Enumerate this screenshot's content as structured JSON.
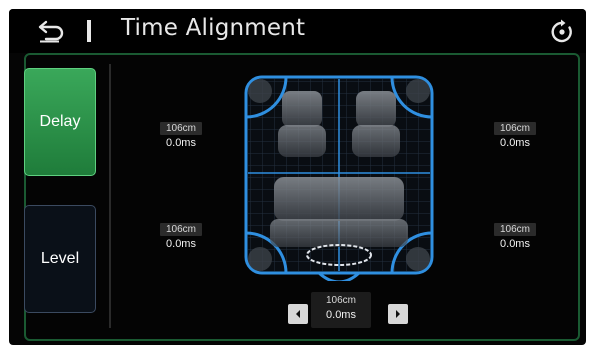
{
  "header": {
    "title": "Time Alignment",
    "back_icon": "back-arrow-icon",
    "reset_icon": "reset-icon"
  },
  "sidebar": {
    "delay_label": "Delay",
    "level_label": "Level",
    "active": "Delay"
  },
  "speakers": {
    "front_left": {
      "distance": "106cm",
      "delay": "0.0ms"
    },
    "front_right": {
      "distance": "106cm",
      "delay": "0.0ms"
    },
    "rear_left": {
      "distance": "106cm",
      "delay": "0.0ms"
    },
    "rear_right": {
      "distance": "106cm",
      "delay": "0.0ms"
    },
    "subwoofer": {
      "distance": "106cm",
      "delay": "0.0ms"
    }
  },
  "controls": {
    "decrease_icon": "chevron-left-icon",
    "increase_icon": "chevron-right-icon"
  },
  "colors": {
    "accent_green": "#2f9c4e",
    "speaker_highlight": "#2f8fe0",
    "panel_border": "#1a5a32"
  }
}
